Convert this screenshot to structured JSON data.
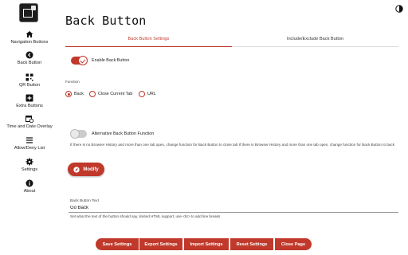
{
  "sidebar": {
    "items": [
      {
        "label": "Navigation Buttons",
        "icon": "home-icon"
      },
      {
        "label": "Back Button",
        "icon": "back-circle-icon"
      },
      {
        "label": "QR Button",
        "icon": "qr-icon"
      },
      {
        "label": "Extra Buttons",
        "icon": "plus-box-icon"
      },
      {
        "label": "Time and Date Overlay",
        "icon": "calendar-clock-icon"
      },
      {
        "label": "Allow/Deny List",
        "icon": "list-icon"
      },
      {
        "label": "Settings",
        "icon": "gear-icon"
      },
      {
        "label": "About",
        "icon": "info-icon"
      }
    ]
  },
  "header": {
    "title": "Back Button"
  },
  "tabs": [
    {
      "label": "Back Button Settings",
      "active": true
    },
    {
      "label": "Include/Exclude Back Button",
      "active": false
    }
  ],
  "settings": {
    "enable_label": "Enable Back Button",
    "enable_on": true,
    "function_label": "Function",
    "radio_options": [
      {
        "label": "Back",
        "checked": true
      },
      {
        "label": "Close Current Tab",
        "checked": false
      },
      {
        "label": "URL",
        "checked": false
      }
    ],
    "alt_label": "Alternative Back Button Function",
    "alt_on": false,
    "alt_description": "If there is no Browser History and more than one tab open, change function for Back Button to close tab If there is Browser History and more than one tab open, change function for Back Button to back",
    "modify_label": "Modify",
    "button_text_label": "Back Button Text",
    "button_text_value": "Go Back",
    "button_text_help": "Set what the text of the button should say, limited HTML support, use <br> to add line breaks"
  },
  "footer": {
    "buttons": [
      "Save Settings",
      "Export Settings",
      "Import Settings",
      "Reset Settings",
      "Close Page"
    ]
  },
  "colors": {
    "accent": "#c0392b"
  }
}
